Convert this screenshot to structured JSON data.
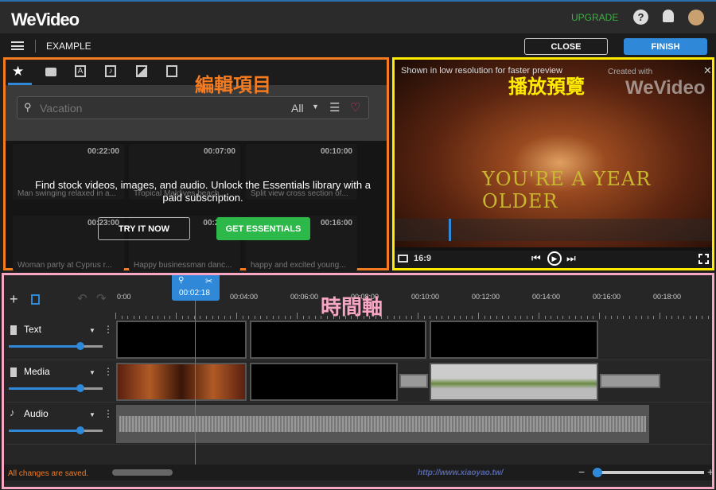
{
  "header": {
    "logo": "WeVideo",
    "upgrade": "UPGRADE",
    "help_icon": "?"
  },
  "subbar": {
    "project_name": "EXAMPLE",
    "close": "CLOSE",
    "finish": "FINISH"
  },
  "library": {
    "annotation": "編輯項目",
    "search_placeholder": "Vacation",
    "filter": "All",
    "tabs": [
      "star-icon",
      "folder-icon",
      "text-icon",
      "music-icon",
      "transition-icon",
      "image-icon"
    ],
    "items": [
      {
        "duration": "00:22:00",
        "caption": "Man swinging relaxed in a..."
      },
      {
        "duration": "00:07:00",
        "caption": "Tropical Maldives beach..."
      },
      {
        "duration": "00:10:00",
        "caption": "Split view cross section of..."
      },
      {
        "duration": "00:23:00",
        "caption": "Woman party at Cyprus r..."
      },
      {
        "duration": "00:2?:00",
        "caption": "Happy businessman danc..."
      },
      {
        "duration": "00:16:00",
        "caption": "happy and excited young..."
      }
    ],
    "overlay_text": "Find stock videos, images, and audio. Unlock the Essentials library with a paid subscription.",
    "try_now": "TRY IT NOW",
    "get_essentials": "GET ESSENTIALS"
  },
  "preview": {
    "annotation": "播放預覽",
    "notice": "Shown in low resolution for faster preview",
    "watermark": "Created with",
    "watermark_logo": "WeVideo",
    "caption": "YOU'RE A YEAR OLDER",
    "aspect": "16:9"
  },
  "timeline": {
    "annotation": "時間軸",
    "playhead": "00:02:18",
    "ticks": [
      "0:00",
      "00:04:00",
      "00:06:00",
      "00:08:00",
      "00:10:00",
      "00:12:00",
      "00:14:00",
      "00:16:00",
      "00:18:00"
    ],
    "tracks": [
      {
        "name": "Text"
      },
      {
        "name": "Media"
      },
      {
        "name": "Audio"
      }
    ],
    "status": "All changes are saved.",
    "watermark_url": "http://www.xiaoyao.tw/"
  }
}
